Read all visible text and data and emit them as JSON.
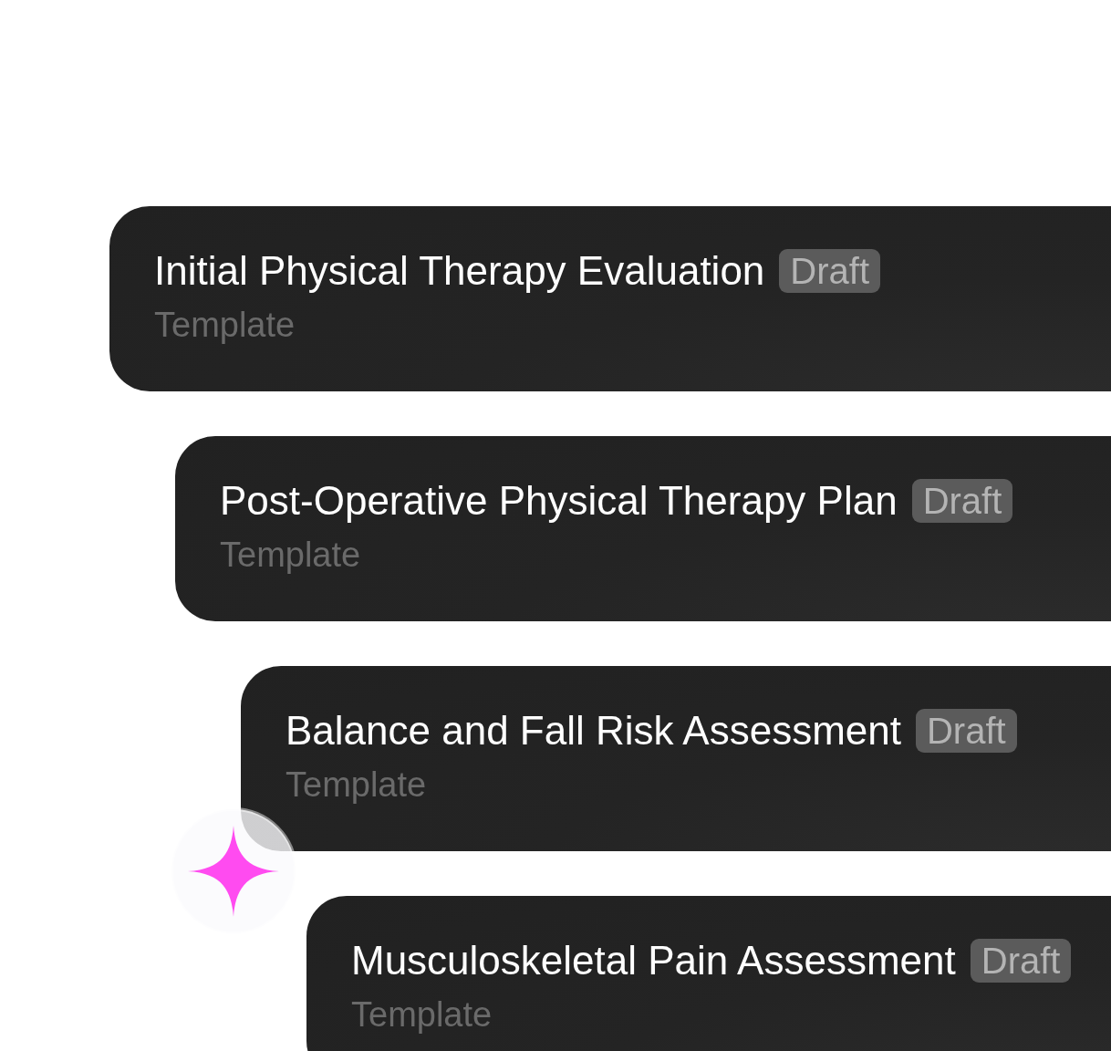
{
  "cards": [
    {
      "title": "Initial Physical Therapy Evaluation",
      "badge": "Draft",
      "subtitle": "Template"
    },
    {
      "title": "Post-Operative Physical Therapy Plan",
      "badge": "Draft",
      "subtitle": "Template"
    },
    {
      "title": "Balance and Fall Risk Assessment",
      "badge": "Draft",
      "subtitle": "Template"
    },
    {
      "title": "Musculoskeletal Pain Assessment",
      "badge": "Draft",
      "subtitle": "Template"
    }
  ]
}
